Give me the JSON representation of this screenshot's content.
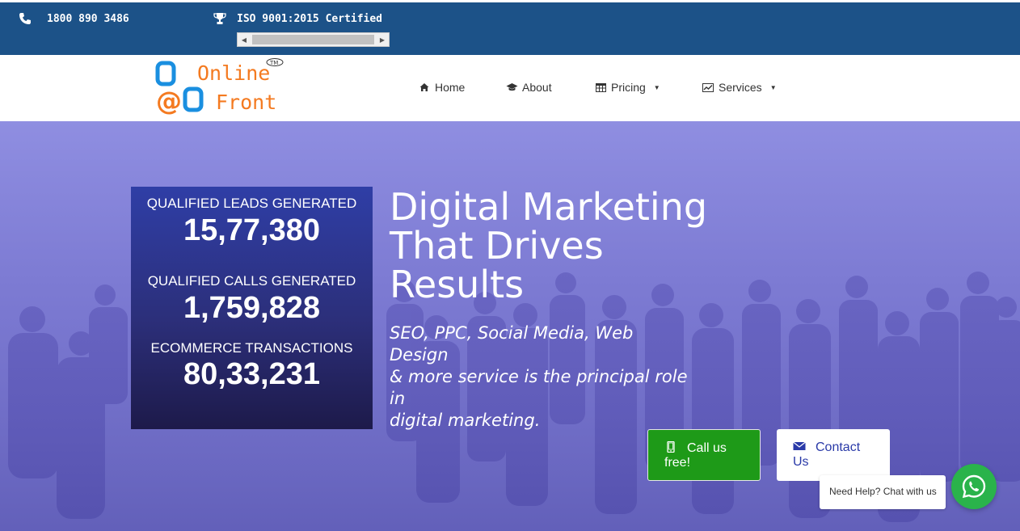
{
  "topbar": {
    "phone": "1800 890 3486",
    "phone_icon": "phone-icon",
    "certification": "ISO 9001:2015 Certified",
    "certification_icon": "trophy-icon"
  },
  "logo": {
    "line1": "Online",
    "line2": "Front",
    "trademark": "TM"
  },
  "nav": {
    "items": [
      {
        "label": "Home",
        "icon": "home-icon"
      },
      {
        "label": "About",
        "icon": "graduation-cap-icon"
      },
      {
        "label": "Pricing",
        "icon": "table-icon",
        "dropdown": true
      },
      {
        "label": "Services",
        "icon": "chart-icon",
        "dropdown": true
      }
    ]
  },
  "stats": [
    {
      "label": "QUALIFIED LEADS GENERATED",
      "value": "15,77,380"
    },
    {
      "label": "QUALIFIED CALLS GENERATED",
      "value": "1,759,828"
    },
    {
      "label": "ECOMMERCE TRANSACTIONS",
      "value": "80,33,231"
    }
  ],
  "hero": {
    "headline_1": "Digital Marketing",
    "headline_2": "That Drives",
    "headline_3": "Results",
    "sub_1": "SEO, PPC, Social Media, Web Design",
    "sub_2": "& more service is the principal role in",
    "sub_3": "digital marketing."
  },
  "cta": {
    "call_label_1": "Call us",
    "call_label_2": "free!",
    "contact_label_1": "Contact",
    "contact_label_2": "Us"
  },
  "chat": {
    "bubble": "Need Help? Chat with us"
  },
  "colors": {
    "topbar": "#1c5288",
    "hero_overlay": "#8f8ee1",
    "call_button": "#1e9a18",
    "whatsapp": "#2ab34b",
    "logo_orange": "#f47a20",
    "logo_blue": "#1a8fe0"
  }
}
